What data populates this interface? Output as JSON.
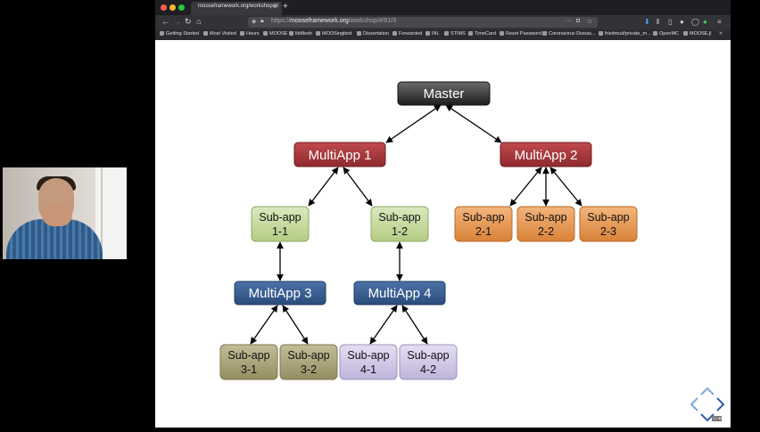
{
  "browser": {
    "tab_title": "mooseframework.org/workshop/#/",
    "url_prefix": "https://",
    "url_domain": "mooseframework.org",
    "url_path": "/workshop/#/61/3",
    "bookmarks": [
      "Getting Started",
      "Most Visited",
      "Hours",
      "MOOSE",
      "libMesh",
      "MOOSingbird",
      "Dissertation",
      "Forwarded",
      "INL",
      "STIMS",
      "TimeCard",
      "Reset Password",
      "Coronavirus Diseas...",
      "friedmud/private_m...",
      "OpenMC",
      "MOOSE.jl"
    ]
  },
  "diagram": {
    "master": "Master",
    "multiapp1": "MultiApp 1",
    "multiapp2": "MultiApp 2",
    "multiapp3": "MultiApp 3",
    "multiapp4": "MultiApp 4",
    "sub_label": "Sub-app",
    "s11": "1-1",
    "s12": "1-2",
    "s21": "2-1",
    "s22": "2-2",
    "s23": "2-3",
    "s31": "3-1",
    "s32": "3-2",
    "s41": "4-1",
    "s42": "4-2"
  },
  "colors": {
    "master": "#3a3a3a",
    "multiapp_red": "#a5363a",
    "multiapp_blue": "#355a8f",
    "sub_green": "#c8dca2",
    "sub_orange": "#ec9f5c",
    "sub_olive": "#aea77d",
    "sub_lavender": "#d3cce6"
  }
}
